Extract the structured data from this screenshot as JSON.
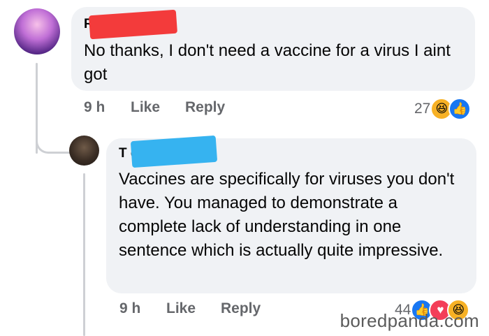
{
  "comment": {
    "author_visible": "R                  ie",
    "text": "No thanks, I don't need a vaccine for a virus I aint got",
    "time": "9 h",
    "like_label": "Like",
    "reply_label": "Reply",
    "reaction_count": "27"
  },
  "reply": {
    "author_visible": "T                  es",
    "text": "Vaccines are specifically for viruses you don't have. You managed to demonstrate a complete lack of understanding in one sentence which is actually quite impressive.",
    "time": "9 h",
    "like_label": "Like",
    "reply_label": "Reply",
    "reaction_count": "44"
  },
  "icons": {
    "haha": "😆",
    "like": "👍",
    "love": "♥"
  },
  "colors": {
    "redaction_red": "#f33b3b",
    "redaction_blue": "#36b3f0",
    "bubble": "#f0f2f5",
    "meta_text": "#65676b",
    "like_blue": "#1877f2",
    "love_red": "#f33e58",
    "haha_yellow": "#f7b125"
  },
  "watermark": "boredpanda.com"
}
